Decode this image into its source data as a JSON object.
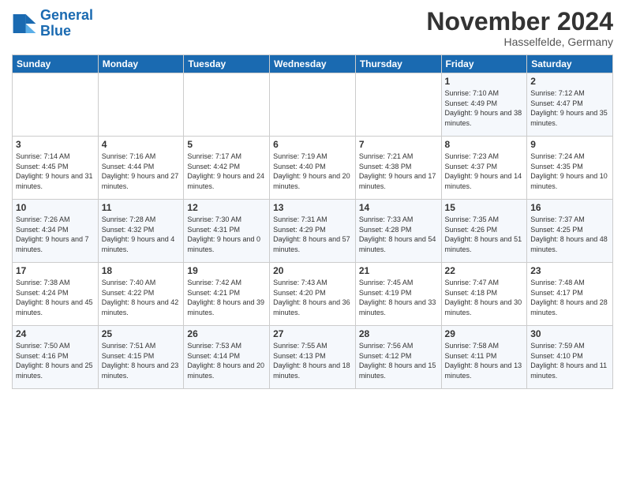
{
  "logo": {
    "line1": "General",
    "line2": "Blue"
  },
  "header": {
    "month": "November 2024",
    "location": "Hasselfelde, Germany"
  },
  "weekdays": [
    "Sunday",
    "Monday",
    "Tuesday",
    "Wednesday",
    "Thursday",
    "Friday",
    "Saturday"
  ],
  "weeks": [
    [
      {
        "day": "",
        "info": ""
      },
      {
        "day": "",
        "info": ""
      },
      {
        "day": "",
        "info": ""
      },
      {
        "day": "",
        "info": ""
      },
      {
        "day": "",
        "info": ""
      },
      {
        "day": "1",
        "info": "Sunrise: 7:10 AM\nSunset: 4:49 PM\nDaylight: 9 hours\nand 38 minutes."
      },
      {
        "day": "2",
        "info": "Sunrise: 7:12 AM\nSunset: 4:47 PM\nDaylight: 9 hours\nand 35 minutes."
      }
    ],
    [
      {
        "day": "3",
        "info": "Sunrise: 7:14 AM\nSunset: 4:45 PM\nDaylight: 9 hours\nand 31 minutes."
      },
      {
        "day": "4",
        "info": "Sunrise: 7:16 AM\nSunset: 4:44 PM\nDaylight: 9 hours\nand 27 minutes."
      },
      {
        "day": "5",
        "info": "Sunrise: 7:17 AM\nSunset: 4:42 PM\nDaylight: 9 hours\nand 24 minutes."
      },
      {
        "day": "6",
        "info": "Sunrise: 7:19 AM\nSunset: 4:40 PM\nDaylight: 9 hours\nand 20 minutes."
      },
      {
        "day": "7",
        "info": "Sunrise: 7:21 AM\nSunset: 4:38 PM\nDaylight: 9 hours\nand 17 minutes."
      },
      {
        "day": "8",
        "info": "Sunrise: 7:23 AM\nSunset: 4:37 PM\nDaylight: 9 hours\nand 14 minutes."
      },
      {
        "day": "9",
        "info": "Sunrise: 7:24 AM\nSunset: 4:35 PM\nDaylight: 9 hours\nand 10 minutes."
      }
    ],
    [
      {
        "day": "10",
        "info": "Sunrise: 7:26 AM\nSunset: 4:34 PM\nDaylight: 9 hours\nand 7 minutes."
      },
      {
        "day": "11",
        "info": "Sunrise: 7:28 AM\nSunset: 4:32 PM\nDaylight: 9 hours\nand 4 minutes."
      },
      {
        "day": "12",
        "info": "Sunrise: 7:30 AM\nSunset: 4:31 PM\nDaylight: 9 hours\nand 0 minutes."
      },
      {
        "day": "13",
        "info": "Sunrise: 7:31 AM\nSunset: 4:29 PM\nDaylight: 8 hours\nand 57 minutes."
      },
      {
        "day": "14",
        "info": "Sunrise: 7:33 AM\nSunset: 4:28 PM\nDaylight: 8 hours\nand 54 minutes."
      },
      {
        "day": "15",
        "info": "Sunrise: 7:35 AM\nSunset: 4:26 PM\nDaylight: 8 hours\nand 51 minutes."
      },
      {
        "day": "16",
        "info": "Sunrise: 7:37 AM\nSunset: 4:25 PM\nDaylight: 8 hours\nand 48 minutes."
      }
    ],
    [
      {
        "day": "17",
        "info": "Sunrise: 7:38 AM\nSunset: 4:24 PM\nDaylight: 8 hours\nand 45 minutes."
      },
      {
        "day": "18",
        "info": "Sunrise: 7:40 AM\nSunset: 4:22 PM\nDaylight: 8 hours\nand 42 minutes."
      },
      {
        "day": "19",
        "info": "Sunrise: 7:42 AM\nSunset: 4:21 PM\nDaylight: 8 hours\nand 39 minutes."
      },
      {
        "day": "20",
        "info": "Sunrise: 7:43 AM\nSunset: 4:20 PM\nDaylight: 8 hours\nand 36 minutes."
      },
      {
        "day": "21",
        "info": "Sunrise: 7:45 AM\nSunset: 4:19 PM\nDaylight: 8 hours\nand 33 minutes."
      },
      {
        "day": "22",
        "info": "Sunrise: 7:47 AM\nSunset: 4:18 PM\nDaylight: 8 hours\nand 30 minutes."
      },
      {
        "day": "23",
        "info": "Sunrise: 7:48 AM\nSunset: 4:17 PM\nDaylight: 8 hours\nand 28 minutes."
      }
    ],
    [
      {
        "day": "24",
        "info": "Sunrise: 7:50 AM\nSunset: 4:16 PM\nDaylight: 8 hours\nand 25 minutes."
      },
      {
        "day": "25",
        "info": "Sunrise: 7:51 AM\nSunset: 4:15 PM\nDaylight: 8 hours\nand 23 minutes."
      },
      {
        "day": "26",
        "info": "Sunrise: 7:53 AM\nSunset: 4:14 PM\nDaylight: 8 hours\nand 20 minutes."
      },
      {
        "day": "27",
        "info": "Sunrise: 7:55 AM\nSunset: 4:13 PM\nDaylight: 8 hours\nand 18 minutes."
      },
      {
        "day": "28",
        "info": "Sunrise: 7:56 AM\nSunset: 4:12 PM\nDaylight: 8 hours\nand 15 minutes."
      },
      {
        "day": "29",
        "info": "Sunrise: 7:58 AM\nSunset: 4:11 PM\nDaylight: 8 hours\nand 13 minutes."
      },
      {
        "day": "30",
        "info": "Sunrise: 7:59 AM\nSunset: 4:10 PM\nDaylight: 8 hours\nand 11 minutes."
      }
    ]
  ]
}
